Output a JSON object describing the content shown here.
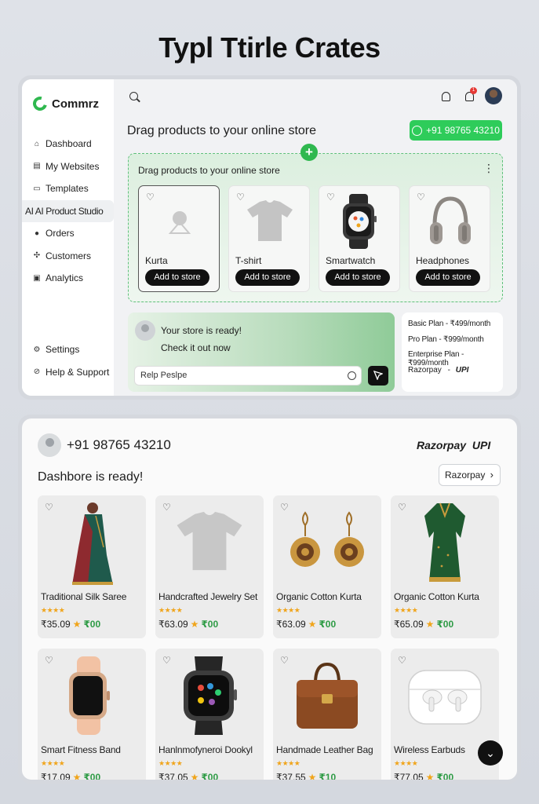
{
  "page_title": "Typl Ttirle Crates",
  "colors": {
    "accent_green": "#2fb84f",
    "whatsapp_green": "#2ecc5a",
    "star_orange": "#f0a51c",
    "dark": "#111111"
  },
  "sidebar": {
    "brand": "Commrz",
    "items": [
      {
        "label": "Dashboard",
        "icon": "home-icon"
      },
      {
        "label": "My Websites",
        "icon": "websites-icon"
      },
      {
        "label": "Templates",
        "icon": "templates-icon"
      },
      {
        "label": "AI AI Product Studio",
        "icon": "",
        "active": true
      },
      {
        "label": "Orders",
        "icon": "orders-icon"
      },
      {
        "label": "Customers",
        "icon": "customers-icon"
      },
      {
        "label": "Analytics",
        "icon": "analytics-icon"
      }
    ],
    "bottom_items": [
      {
        "label": "Settings",
        "icon": "gear-icon"
      },
      {
        "label": "Help & Support",
        "icon": "help-icon"
      }
    ]
  },
  "header": {
    "heading": "Drag products to your online store",
    "whatsapp_number": "+91 98765 43210",
    "notification_count": "1"
  },
  "dropzone": {
    "title": "Drag products to your online store",
    "add_label": "+",
    "cards": [
      {
        "label": "Kurta",
        "button": "Add to store",
        "icon": "person-placeholder-icon"
      },
      {
        "label": "T-shirt",
        "button": "Add to store",
        "icon": "tshirt-icon"
      },
      {
        "label": "Smartwatch",
        "button": "Add to store",
        "icon": "smartwatch-icon"
      },
      {
        "label": "Headphones",
        "button": "Add to store",
        "icon": "headphones-icon"
      }
    ]
  },
  "ready_card": {
    "line1": "Your store is ready!",
    "line2": "Check it out now",
    "input_value": "Relp Peslpe"
  },
  "plans": {
    "items": [
      "Basic Plan - ₹499/month",
      "Pro Plan - ₹999/month",
      "Enterprise Plan - ₹999/month"
    ],
    "payment": "Razorpay",
    "payment_sep": "-",
    "upi": "UPI"
  },
  "dashboard": {
    "phone": "+91 98765 43210",
    "razorpay": "Razorpay",
    "upi": "UPI",
    "title": "Dashbore is ready!",
    "select_value": "Razorpay",
    "products": [
      {
        "name": "Traditional Silk Saree",
        "price": "₹35.09",
        "extra": "₹00",
        "icon": "saree-icon"
      },
      {
        "name": "Handcrafted Jewelry Set",
        "price": "₹63.09",
        "extra": "₹00",
        "icon": "tshirt-icon"
      },
      {
        "name": "Organic Cotton Kurta",
        "price": "₹63.09",
        "extra": "₹00",
        "icon": "earrings-icon"
      },
      {
        "name": "Organic Cotton Kurta",
        "price": "₹65.09",
        "extra": "₹00",
        "icon": "kurta-icon"
      },
      {
        "name": "Smart Fitness Band",
        "price": "₹17.09",
        "extra": "₹00",
        "icon": "fitness-band-icon"
      },
      {
        "name": "Hanlnmofyneroi Dookyl",
        "price": "₹37.05",
        "extra": "₹00",
        "icon": "smartwatch-icon"
      },
      {
        "name": "Handmade Leather Bag",
        "price": "₹37.55",
        "extra": "₹10",
        "icon": "bag-icon"
      },
      {
        "name": "Wireless Earbuds",
        "price": "₹77.05",
        "extra": "₹00",
        "icon": "earbuds-icon"
      }
    ],
    "rating_stars": "★★★★"
  }
}
